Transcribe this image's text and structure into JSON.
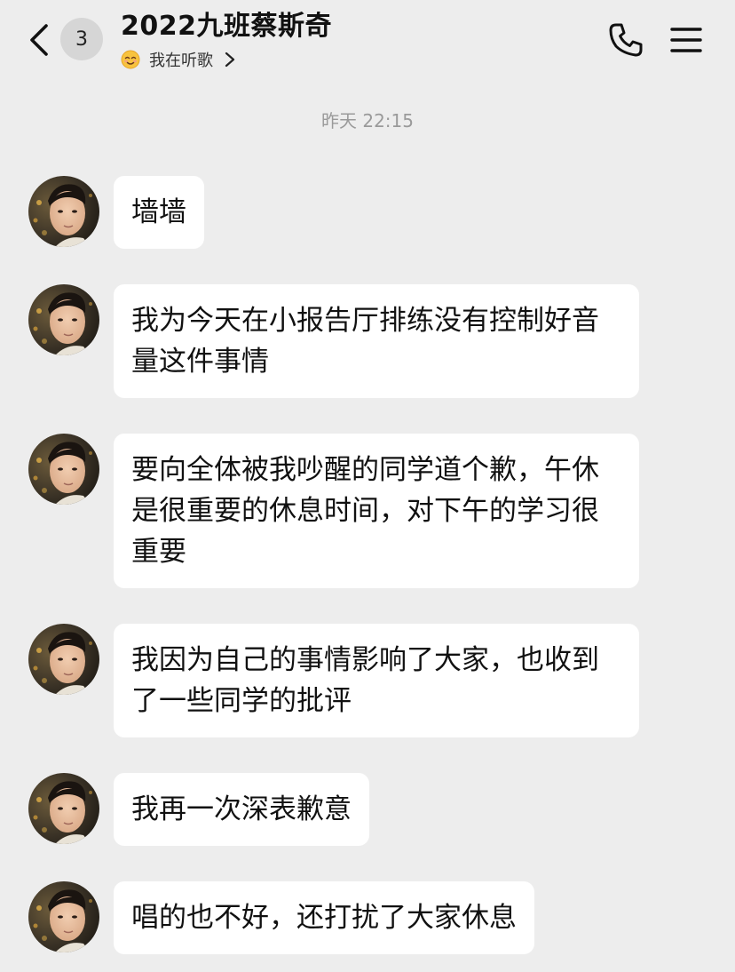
{
  "header": {
    "unread_count": "3",
    "title": "2022九班蔡斯奇",
    "status_text": "我在听歌",
    "status_icon": "smiling-emoji-icon",
    "back_icon": "chevron-left-icon",
    "call_icon": "phone-icon",
    "menu_icon": "hamburger-menu-icon"
  },
  "timestamp": "昨天 22:15",
  "messages": [
    {
      "text": "墙墙"
    },
    {
      "text": "我为今天在小报告厅排练没有控制好音量这件事情"
    },
    {
      "text": "要向全体被我吵醒的同学道个歉，午休是很重要的休息时间，对下午的学习很重要"
    },
    {
      "text": "我因为自己的事情影响了大家，也收到了一些同学的批评"
    },
    {
      "text": "我再一次深表歉意"
    },
    {
      "text": "唱的也不好，还打扰了大家休息"
    }
  ],
  "colors": {
    "background": "#EDEDED",
    "bubble": "#FFFFFF",
    "timestamp": "#9A9A9A",
    "badge": "#D6D6D6"
  }
}
